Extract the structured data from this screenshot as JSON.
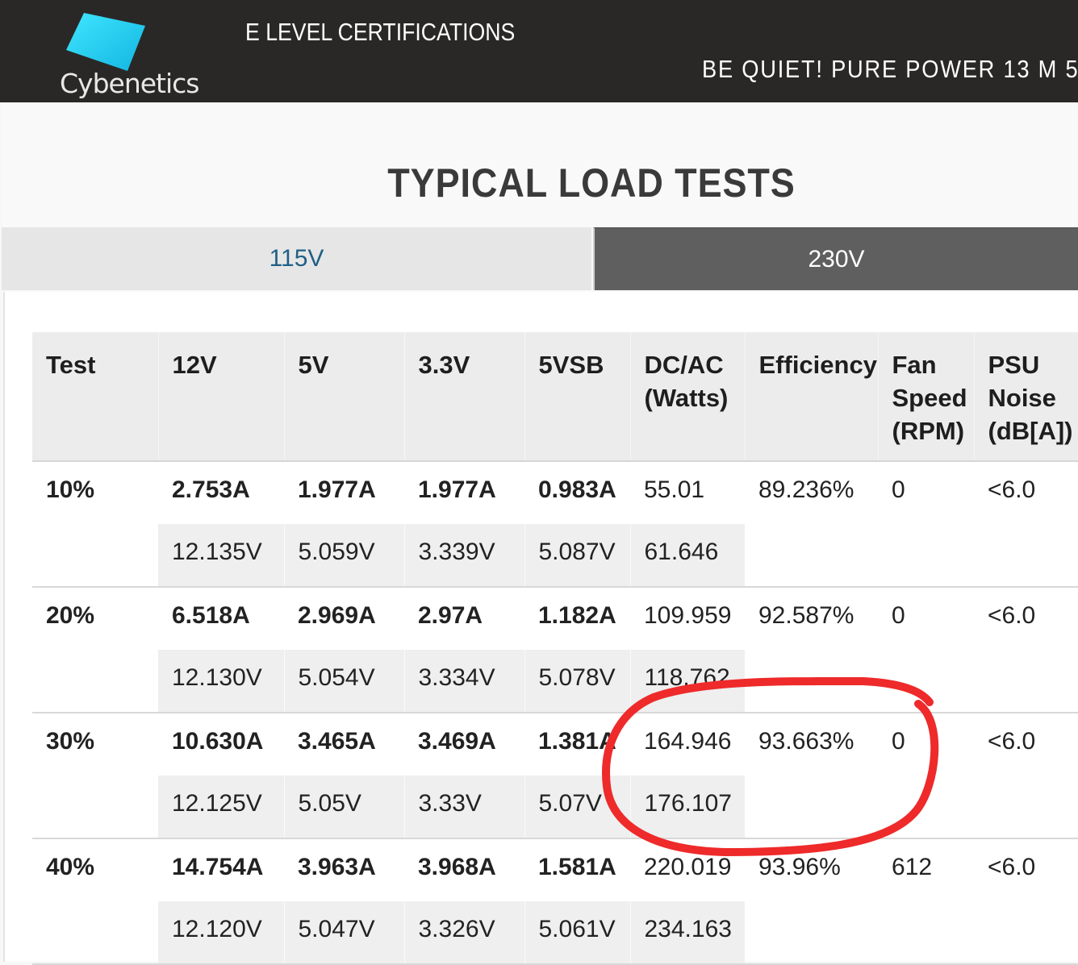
{
  "header": {
    "logo_text": "Cybenetics",
    "cert_title": "E LEVEL CERTIFICATIONS",
    "model_title": "BE QUIET! PURE POWER 13 M 5"
  },
  "section_title": "TYPICAL LOAD TESTS",
  "tabs": [
    {
      "label": "115V",
      "active": true
    },
    {
      "label": "230V",
      "active": false
    }
  ],
  "table": {
    "headers": {
      "test": "Test",
      "v12": "12V",
      "v5": "5V",
      "v33": "3.3V",
      "vsb": "5VSB",
      "dcac": "DC/AC (Watts)",
      "efficiency": "Efficiency",
      "fan": "Fan Speed (RPM)",
      "noise": "PSU Noise (dB[A])"
    },
    "rows": [
      {
        "test": "10%",
        "amps": [
          "2.753A",
          "1.977A",
          "1.977A",
          "0.983A"
        ],
        "volts": [
          "12.135V",
          "5.059V",
          "3.339V",
          "5.087V"
        ],
        "dc": "55.01",
        "ac": "61.646",
        "efficiency": "89.236%",
        "fan": "0",
        "noise": "<6.0"
      },
      {
        "test": "20%",
        "amps": [
          "6.518A",
          "2.969A",
          "2.97A",
          "1.182A"
        ],
        "volts": [
          "12.130V",
          "5.054V",
          "3.334V",
          "5.078V"
        ],
        "dc": "109.959",
        "ac": "118.762",
        "efficiency": "92.587%",
        "fan": "0",
        "noise": "<6.0"
      },
      {
        "test": "30%",
        "amps": [
          "10.630A",
          "3.465A",
          "3.469A",
          "1.381A"
        ],
        "volts": [
          "12.125V",
          "5.05V",
          "3.33V",
          "5.07V"
        ],
        "dc": "164.946",
        "ac": "176.107",
        "efficiency": "93.663%",
        "fan": "0",
        "noise": "<6.0"
      },
      {
        "test": "40%",
        "amps": [
          "14.754A",
          "3.963A",
          "3.968A",
          "1.581A"
        ],
        "volts": [
          "12.120V",
          "5.047V",
          "3.326V",
          "5.061V"
        ],
        "dc": "220.019",
        "ac": "234.163",
        "efficiency": "93.96%",
        "fan": "612",
        "noise": "<6.0"
      }
    ]
  },
  "colors": {
    "header_bg": "#2a2827",
    "logo_cyan": "#2fd0f0",
    "tab_active_text": "#1f5f86",
    "tab_inactive_bg": "#5f5f5f",
    "annotation_red": "#ee2a2a"
  }
}
